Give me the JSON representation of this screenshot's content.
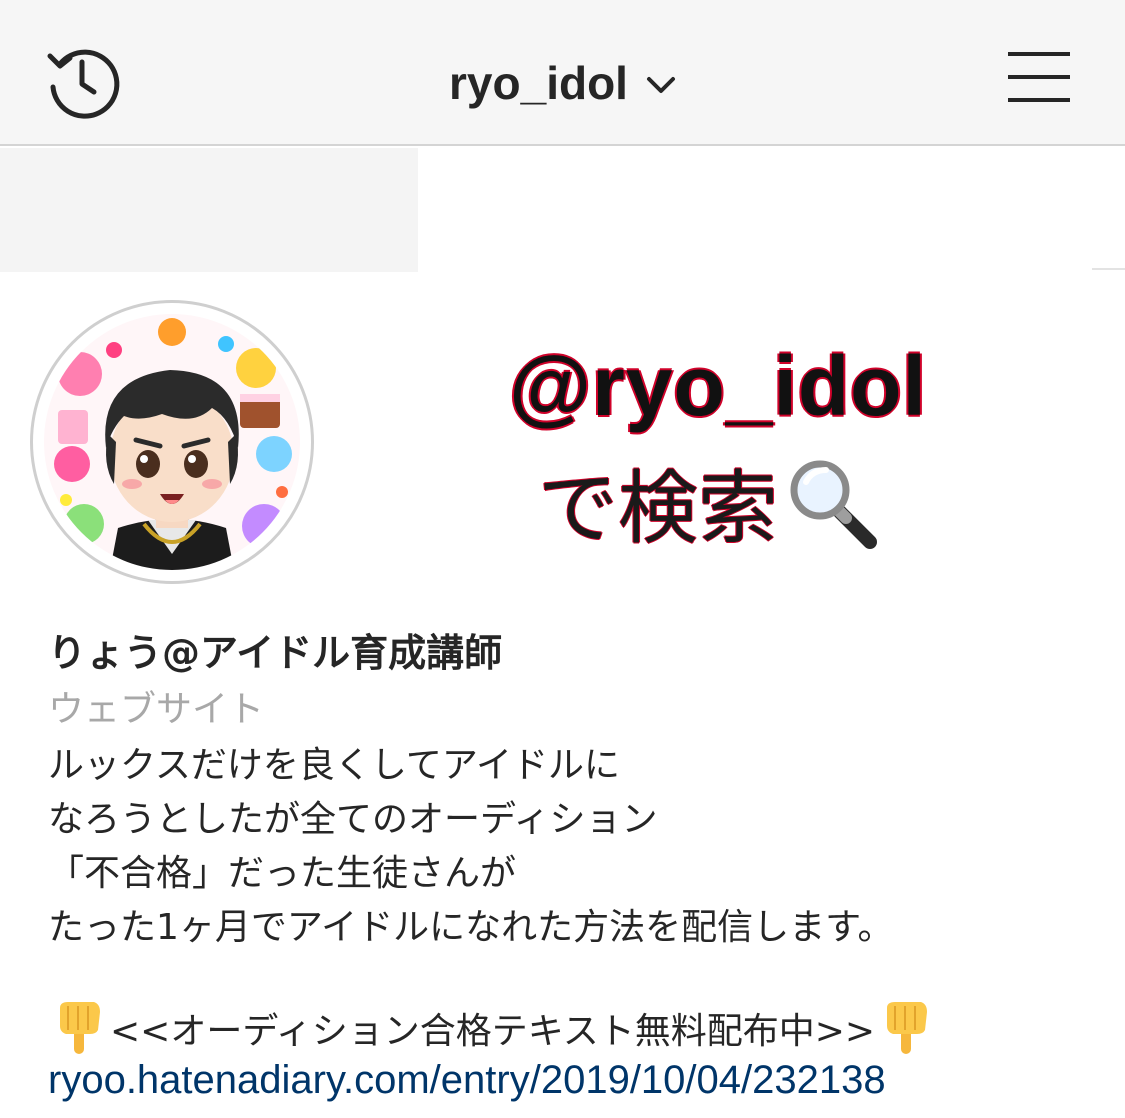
{
  "header": {
    "username": "ryo_idol",
    "left_icon": "history-icon",
    "dropdown_icon": "chevron-down-icon",
    "right_icon": "menu-icon"
  },
  "profile": {
    "avatar_alt": "profile-picture",
    "banner_handle": "@ryo_idol",
    "banner_search_text": "で検索",
    "banner_search_icon": "magnifying-glass-icon",
    "display_name": "りょう@アイドル育成講師",
    "category": "ウェブサイト",
    "bio_lines": [
      "ルックスだけを良くしてアイドルに",
      "なろうとしたが全てのオーディション",
      "「不合格」だった生徒さんが",
      "たった1ヶ月でアイドルになれた方法を配信します。"
    ],
    "promo_text": "<<オーディション合格テキスト無料配布中>>",
    "promo_icon": "pointing-down-hand-icon",
    "link": "ryoo.hatenadiary.com/entry/2019/10/04/232138"
  },
  "colors": {
    "header_bg": "#f6f6f6",
    "text": "#262626",
    "muted": "#a8a8a8",
    "link": "#003569",
    "banner_outline": "#d0022a"
  }
}
